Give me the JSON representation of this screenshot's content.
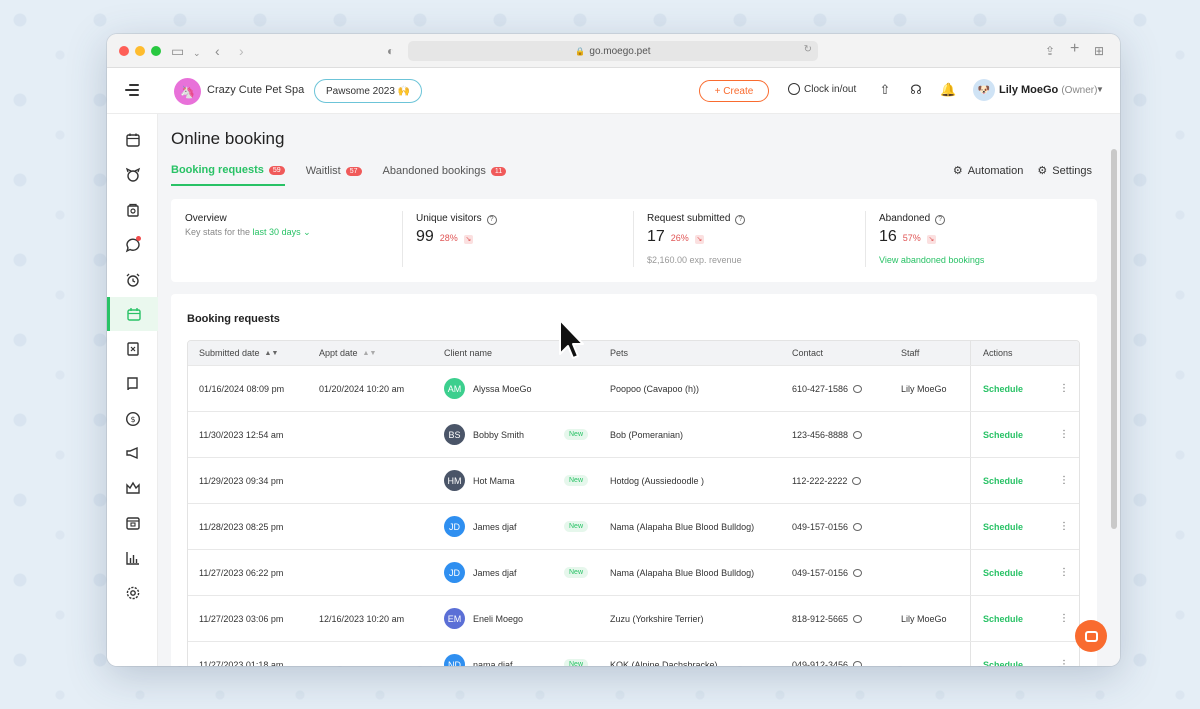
{
  "browser": {
    "url": "go.moego.pet"
  },
  "header": {
    "business_name": "Crazy Cute Pet Spa",
    "business_initial": "🦄",
    "promo_label": "Pawsome 2023 🙌",
    "create_label": "+ Create",
    "clock_label": "Clock in/out",
    "user_name": "Lily MoeGo",
    "user_role": "(Owner)"
  },
  "sidebar": {
    "items": [
      "menu-icon",
      "calendar-icon",
      "pet-icon",
      "store-icon",
      "message-icon",
      "alarm-clock-icon",
      "online-booking-icon",
      "form-icon",
      "book-icon",
      "dollar-icon",
      "megaphone-icon",
      "crown-icon",
      "inbox-icon",
      "chart-icon",
      "gear-icon"
    ],
    "active": "online-booking-icon"
  },
  "page": {
    "title": "Online booking",
    "tabs": [
      {
        "label": "Booking requests",
        "count": "59",
        "active": true
      },
      {
        "label": "Waitlist",
        "count": "57",
        "active": false
      },
      {
        "label": "Abandoned bookings",
        "count": "11",
        "active": false
      }
    ],
    "automation_label": "Automation",
    "settings_label": "Settings"
  },
  "overview": {
    "title": "Overview",
    "subtitle": "Key stats for the",
    "range": "last 30 days",
    "stats": [
      {
        "label": "Unique visitors",
        "value": "99",
        "change": "28%",
        "extra": ""
      },
      {
        "label": "Request submitted",
        "value": "17",
        "change": "26%",
        "extra": "$2,160.00 exp. revenue"
      },
      {
        "label": "Abandoned",
        "value": "16",
        "change": "57%",
        "link": "View abandoned bookings"
      }
    ]
  },
  "requests": {
    "title": "Booking requests",
    "columns": [
      "Submitted date",
      "Appt date",
      "Client name",
      "Pets",
      "Contact",
      "Staff",
      "Actions"
    ],
    "action_label": "Schedule",
    "new_label": "New",
    "rows": [
      {
        "submitted": "01/16/2024 08:09 pm",
        "appt": "01/20/2024 10:20 am",
        "initials": "AM",
        "color": "#3ccf8e",
        "client": "Alyssa MoeGo",
        "is_new": false,
        "pets": "Poopoo (Cavapoo (h))",
        "contact": "610-427-1586",
        "staff": "Lily MoeGo"
      },
      {
        "submitted": "11/30/2023 12:54 am",
        "appt": "",
        "initials": "BS",
        "color": "#4a5568",
        "client": "Bobby Smith",
        "is_new": true,
        "pets": "Bob (Pomeranian)",
        "contact": "123-456-8888",
        "staff": ""
      },
      {
        "submitted": "11/29/2023 09:34 pm",
        "appt": "",
        "initials": "HM",
        "color": "#4a5568",
        "client": "Hot Mama",
        "is_new": true,
        "pets": "Hotdog (Aussiedoodle )",
        "contact": "112-222-2222",
        "staff": ""
      },
      {
        "submitted": "11/28/2023 08:25 pm",
        "appt": "",
        "initials": "JD",
        "color": "#2f8ff0",
        "client": "James djaf",
        "is_new": true,
        "pets": "Nama (Alapaha Blue Blood Bulldog)",
        "contact": "049-157-0156",
        "staff": ""
      },
      {
        "submitted": "11/27/2023 06:22 pm",
        "appt": "",
        "initials": "JD",
        "color": "#2f8ff0",
        "client": "James djaf",
        "is_new": true,
        "pets": "Nama (Alapaha Blue Blood Bulldog)",
        "contact": "049-157-0156",
        "staff": ""
      },
      {
        "submitted": "11/27/2023 03:06 pm",
        "appt": "12/16/2023 10:20 am",
        "initials": "EM",
        "color": "#5b6fd6",
        "client": "Eneli Moego",
        "is_new": false,
        "pets": "Zuzu (Yorkshire Terrier)",
        "contact": "818-912-5665",
        "staff": "Lily MoeGo"
      },
      {
        "submitted": "11/27/2023 01:18 am",
        "appt": "",
        "initials": "ND",
        "color": "#2f8ff0",
        "client": "nama djaf",
        "is_new": true,
        "pets": "KOK (Alpine Dachsbracke)",
        "contact": "049-912-3456",
        "staff": ""
      }
    ]
  },
  "colors": {
    "accent": "#29c266",
    "brand_orange": "#f96b2f",
    "badge_red": "#f05a5a"
  }
}
